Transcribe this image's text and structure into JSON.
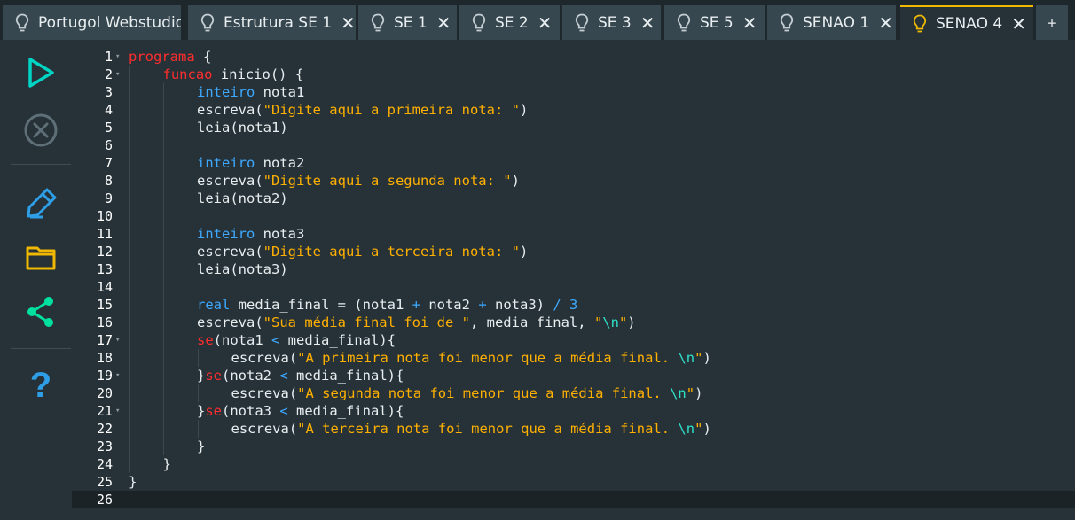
{
  "tabs": [
    {
      "label": "Portugol Webstudio",
      "closable": false,
      "active": false
    },
    {
      "label": "Estrutura SE 1",
      "closable": true,
      "active": false
    },
    {
      "label": "SE 1",
      "closable": true,
      "active": false
    },
    {
      "label": "SE 2",
      "closable": true,
      "active": false
    },
    {
      "label": "SE 3",
      "closable": true,
      "active": false
    },
    {
      "label": "SE 5",
      "closable": true,
      "active": false
    },
    {
      "label": "SENAO 1",
      "closable": true,
      "active": false
    },
    {
      "label": "SENAO 4",
      "closable": true,
      "active": true
    }
  ],
  "new_tab_label": "+",
  "sidebar": {
    "icons": [
      "run-icon",
      "stop-icon",
      "edit-icon",
      "folder-icon",
      "share-icon",
      "help-icon"
    ],
    "help_glyph": "?"
  },
  "colors": {
    "accent": "#f0b800",
    "keyword": "#ff2d2d",
    "type": "#3ea9ff",
    "string": "#ffb000",
    "escape": "#2fe0c8",
    "run": "#00d4c4",
    "share": "#00e0a0"
  },
  "editor": {
    "current_line": 26,
    "lines": [
      {
        "n": "1",
        "fold": true,
        "indent": 0,
        "tokens": [
          [
            "kw",
            "programa"
          ],
          [
            "p",
            " {"
          ]
        ]
      },
      {
        "n": "2",
        "fold": true,
        "indent": 1,
        "tokens": [
          [
            "kw",
            "funcao"
          ],
          [
            "p",
            " inicio() {"
          ]
        ]
      },
      {
        "n": "3",
        "fold": false,
        "indent": 2,
        "tokens": [
          [
            "ty",
            "inteiro"
          ],
          [
            "p",
            " nota1"
          ]
        ]
      },
      {
        "n": "4",
        "fold": false,
        "indent": 2,
        "tokens": [
          [
            "p",
            "escreva("
          ],
          [
            "str",
            "\"Digite aqui a primeira nota: \""
          ],
          [
            "p",
            ")"
          ]
        ]
      },
      {
        "n": "5",
        "fold": false,
        "indent": 2,
        "tokens": [
          [
            "p",
            "leia(nota1)"
          ]
        ]
      },
      {
        "n": "6",
        "fold": false,
        "indent": 2,
        "tokens": []
      },
      {
        "n": "7",
        "fold": false,
        "indent": 2,
        "tokens": [
          [
            "ty",
            "inteiro"
          ],
          [
            "p",
            " nota2"
          ]
        ]
      },
      {
        "n": "8",
        "fold": false,
        "indent": 2,
        "tokens": [
          [
            "p",
            "escreva("
          ],
          [
            "str",
            "\"Digite aqui a segunda nota: \""
          ],
          [
            "p",
            ")"
          ]
        ]
      },
      {
        "n": "9",
        "fold": false,
        "indent": 2,
        "tokens": [
          [
            "p",
            "leia(nota2)"
          ]
        ]
      },
      {
        "n": "10",
        "fold": false,
        "indent": 2,
        "tokens": []
      },
      {
        "n": "11",
        "fold": false,
        "indent": 2,
        "tokens": [
          [
            "ty",
            "inteiro"
          ],
          [
            "p",
            " nota3"
          ]
        ]
      },
      {
        "n": "12",
        "fold": false,
        "indent": 2,
        "tokens": [
          [
            "p",
            "escreva("
          ],
          [
            "str",
            "\"Digite aqui a terceira nota: \""
          ],
          [
            "p",
            ")"
          ]
        ]
      },
      {
        "n": "13",
        "fold": false,
        "indent": 2,
        "tokens": [
          [
            "p",
            "leia(nota3)"
          ]
        ]
      },
      {
        "n": "14",
        "fold": false,
        "indent": 2,
        "tokens": []
      },
      {
        "n": "15",
        "fold": false,
        "indent": 2,
        "tokens": [
          [
            "ty",
            "real"
          ],
          [
            "p",
            " media_final = (nota1 "
          ],
          [
            "op",
            "+"
          ],
          [
            "p",
            " nota2 "
          ],
          [
            "op",
            "+"
          ],
          [
            "p",
            " nota3) "
          ],
          [
            "op",
            "/"
          ],
          [
            "p",
            " "
          ],
          [
            "num",
            "3"
          ]
        ]
      },
      {
        "n": "16",
        "fold": false,
        "indent": 2,
        "tokens": [
          [
            "p",
            "escreva("
          ],
          [
            "str",
            "\"Sua média final foi de \""
          ],
          [
            "p",
            ", media_final, "
          ],
          [
            "str",
            "\""
          ],
          [
            "esc",
            "\\n"
          ],
          [
            "str",
            "\""
          ],
          [
            "p",
            ")"
          ]
        ]
      },
      {
        "n": "17",
        "fold": true,
        "indent": 2,
        "tokens": [
          [
            "kw",
            "se"
          ],
          [
            "p",
            "(nota1 "
          ],
          [
            "op",
            "<"
          ],
          [
            "p",
            " media_final){"
          ]
        ]
      },
      {
        "n": "18",
        "fold": false,
        "indent": 3,
        "tokens": [
          [
            "p",
            "escreva("
          ],
          [
            "str",
            "\"A primeira nota foi menor que a média final. "
          ],
          [
            "esc",
            "\\n"
          ],
          [
            "str",
            "\""
          ],
          [
            "p",
            ")"
          ]
        ]
      },
      {
        "n": "19",
        "fold": true,
        "indent": 2,
        "tokens": [
          [
            "p",
            "}"
          ],
          [
            "kw",
            "se"
          ],
          [
            "p",
            "(nota2 "
          ],
          [
            "op",
            "<"
          ],
          [
            "p",
            " media_final){"
          ]
        ]
      },
      {
        "n": "20",
        "fold": false,
        "indent": 3,
        "tokens": [
          [
            "p",
            "escreva("
          ],
          [
            "str",
            "\"A segunda nota foi menor que a média final. "
          ],
          [
            "esc",
            "\\n"
          ],
          [
            "str",
            "\""
          ],
          [
            "p",
            ")"
          ]
        ]
      },
      {
        "n": "21",
        "fold": true,
        "indent": 2,
        "tokens": [
          [
            "p",
            "}"
          ],
          [
            "kw",
            "se"
          ],
          [
            "p",
            "(nota3 "
          ],
          [
            "op",
            "<"
          ],
          [
            "p",
            " media_final){"
          ]
        ]
      },
      {
        "n": "22",
        "fold": false,
        "indent": 3,
        "tokens": [
          [
            "p",
            "escreva("
          ],
          [
            "str",
            "\"A terceira nota foi menor que a média final. "
          ],
          [
            "esc",
            "\\n"
          ],
          [
            "str",
            "\""
          ],
          [
            "p",
            ")"
          ]
        ]
      },
      {
        "n": "23",
        "fold": false,
        "indent": 2,
        "tokens": [
          [
            "p",
            "}"
          ]
        ]
      },
      {
        "n": "24",
        "fold": false,
        "indent": 1,
        "tokens": [
          [
            "p",
            "}"
          ]
        ]
      },
      {
        "n": "25",
        "fold": false,
        "indent": 0,
        "tokens": [
          [
            "p",
            "}"
          ]
        ]
      },
      {
        "n": "26",
        "fold": false,
        "indent": 0,
        "tokens": []
      }
    ]
  }
}
